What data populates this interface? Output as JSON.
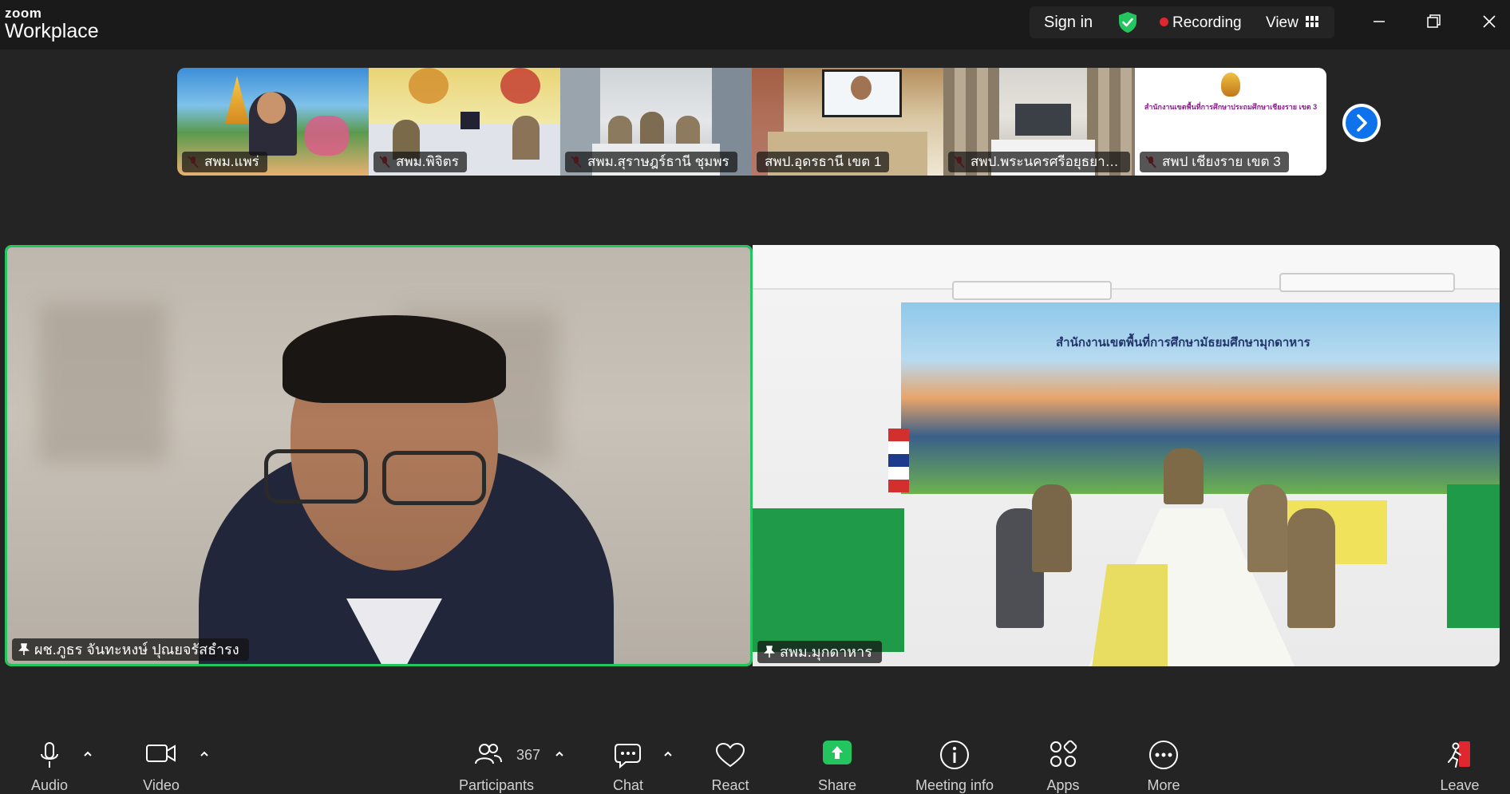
{
  "app": {
    "brand_small": "zoom",
    "brand_large": "Workplace"
  },
  "titlebar": {
    "sign_in": "Sign in",
    "recording": "Recording",
    "view": "View"
  },
  "colors": {
    "accent_blue": "#0e72ed",
    "active_speaker_green": "#22c55e",
    "record_red": "#e0262f",
    "background": "#242424"
  },
  "thumbnails": [
    {
      "name": "สพม.แพร่",
      "muted": true
    },
    {
      "name": "สพม.พิจิตร",
      "muted": true
    },
    {
      "name": "สพม.สุราษฎร์ธานี ชุมพร",
      "muted": true
    },
    {
      "name": "สพป.อุดรธานี เขต 1",
      "muted": false
    },
    {
      "name": "สพป.พระนครศรีอยุธยา เข...",
      "muted": true
    },
    {
      "name": "สพป เชียงราย เขต 3",
      "muted": true
    }
  ],
  "main_videos": {
    "left": {
      "name": "ผช.ภูธร จันทะหงษ์ ปุณยจรัสธำรง"
    },
    "right": {
      "name": "สพม.มุกดาหาร",
      "banner": "สำนักงานเขตพื้นที่การศึกษามัธยมศึกษามุกดาหาร"
    }
  },
  "thumb4_banner": "สำนักงานเขตพื้นที่การศึกษาประถมศึกษาเชียงราย เขต 3",
  "toolbar": {
    "audio": "Audio",
    "video": "Video",
    "participants": "Participants",
    "participants_count": "367",
    "chat": "Chat",
    "react": "React",
    "share": "Share",
    "meeting_info": "Meeting info",
    "apps": "Apps",
    "more": "More",
    "leave": "Leave"
  }
}
